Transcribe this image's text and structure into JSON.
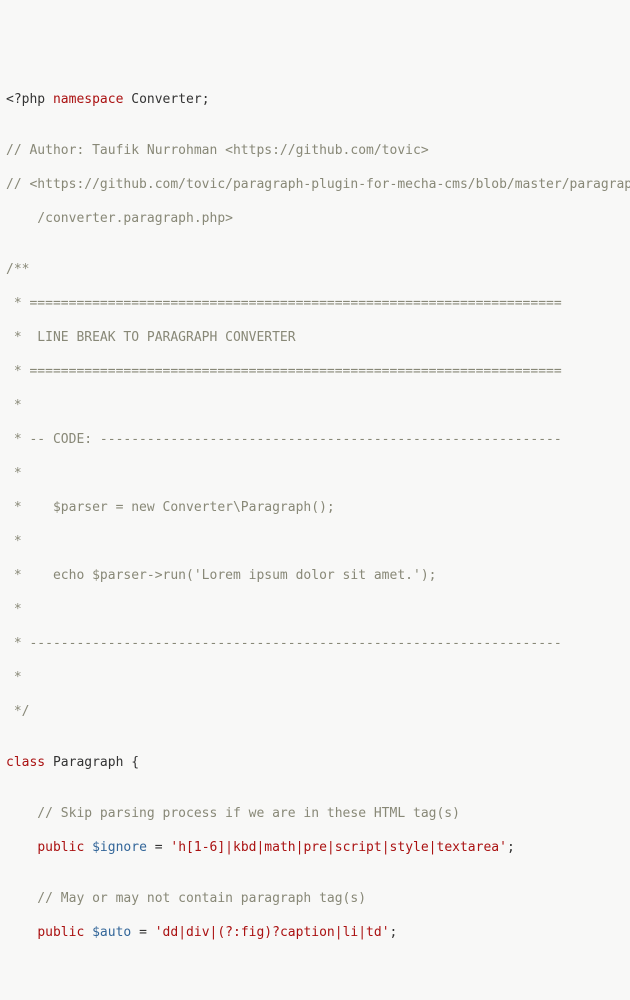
{
  "lines": {
    "l1": {
      "t1": "<?php",
      "t2": " ",
      "t3": "namespace",
      "t4": " Converter;"
    },
    "l2": "",
    "l3": "// Author: Taufik Nurrohman <https://github.com/tovic>",
    "l4": "// <https://github.com/tovic/paragraph-plugin-for-mecha-cms/blob/master/paragraph",
    "l5": "    /converter.paragraph.php>",
    "l6": "",
    "l7": "/**",
    "l8": " * ====================================================================",
    "l9": " *  LINE BREAK TO PARAGRAPH CONVERTER",
    "l10": " * ====================================================================",
    "l11": " *",
    "l12": " * -- CODE: -----------------------------------------------------------",
    "l13": " *",
    "l14": " *    $parser = new Converter\\Paragraph();",
    "l15": " *",
    "l16": " *    echo $parser->run('Lorem ipsum dolor sit amet.');",
    "l17": " *",
    "l18": " * --------------------------------------------------------------------",
    "l19": " *",
    "l20": " */",
    "l21": "",
    "l22": {
      "t1": "class",
      "t2": " Paragraph {"
    },
    "l23": "",
    "l24": "    // Skip parsing process if we are in these HTML tag(s)",
    "l25": {
      "t1": "    ",
      "t2": "public",
      "t3": " ",
      "t4": "$ignore",
      "t5": " = ",
      "t6": "'h[1-6]|kbd|math|pre|script|style|textarea'",
      "t7": ";"
    },
    "l26": "",
    "l27": "    // May or may not contain paragraph tag(s)",
    "l28": {
      "t1": "    ",
      "t2": "public",
      "t3": " ",
      "t4": "$auto",
      "t5": " = ",
      "t6": "'dd|div|(?:fig)?caption|li|td'",
      "t7": ";"
    }
  }
}
